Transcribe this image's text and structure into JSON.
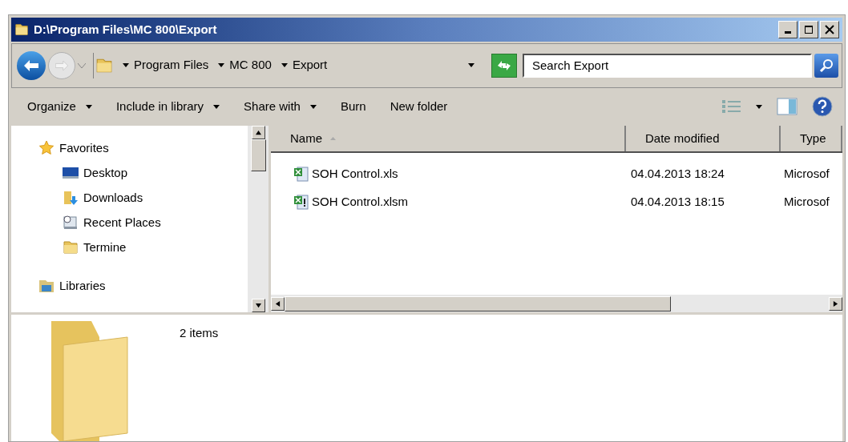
{
  "window": {
    "title": "D:\\Program Files\\MC 800\\Export"
  },
  "address": {
    "crumbs": [
      "Program Files",
      "MC 800",
      "Export"
    ]
  },
  "search": {
    "placeholder": "Search Export"
  },
  "toolbar": [
    {
      "label": "Organize",
      "dropdown": true
    },
    {
      "label": "Include in library",
      "dropdown": true
    },
    {
      "label": "Share with",
      "dropdown": true
    },
    {
      "label": "Burn",
      "dropdown": false
    },
    {
      "label": "New folder",
      "dropdown": false
    }
  ],
  "sidebar": {
    "items": [
      {
        "label": "Favorites",
        "kind": "star",
        "children": [
          {
            "label": "Desktop",
            "kind": "desktop"
          },
          {
            "label": "Downloads",
            "kind": "downloads"
          },
          {
            "label": "Recent Places",
            "kind": "recent"
          },
          {
            "label": "Termine",
            "kind": "folder"
          }
        ]
      },
      {
        "label": "Libraries",
        "kind": "library"
      }
    ]
  },
  "table": {
    "columns": [
      "Name",
      "Date modified",
      "Type"
    ],
    "rows": [
      {
        "name": "SOH Control.xls",
        "date": "04.04.2013 18:24",
        "type": "Microsof",
        "kind": "xls"
      },
      {
        "name": "SOH Control.xlsm",
        "date": "04.04.2013 18:15",
        "type": "Microsof",
        "kind": "xlsm"
      }
    ]
  },
  "details": {
    "count": "2 items"
  }
}
